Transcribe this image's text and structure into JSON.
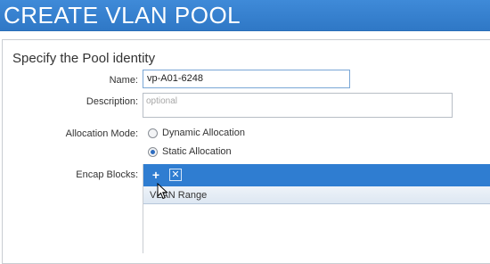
{
  "window": {
    "title": "CREATE VLAN POOL"
  },
  "form": {
    "section_title": "Specify the Pool identity",
    "name": {
      "label": "Name:",
      "value": "vp-A01-6248"
    },
    "description": {
      "label": "Description:",
      "placeholder": "optional"
    },
    "allocation_mode": {
      "label": "Allocation Mode:",
      "options": [
        "Dynamic Allocation",
        "Static Allocation"
      ],
      "selected": "Static Allocation"
    },
    "encap_blocks": {
      "label": "Encap Blocks:",
      "toolbar": {
        "add_icon": "plus-icon",
        "delete_icon": "x-box-icon"
      },
      "columns": [
        "VLAN Range"
      ]
    }
  },
  "colors": {
    "title_bar": "#3484d3",
    "toolbar": "#2f7dd1",
    "accent": "#2d6cc0"
  }
}
